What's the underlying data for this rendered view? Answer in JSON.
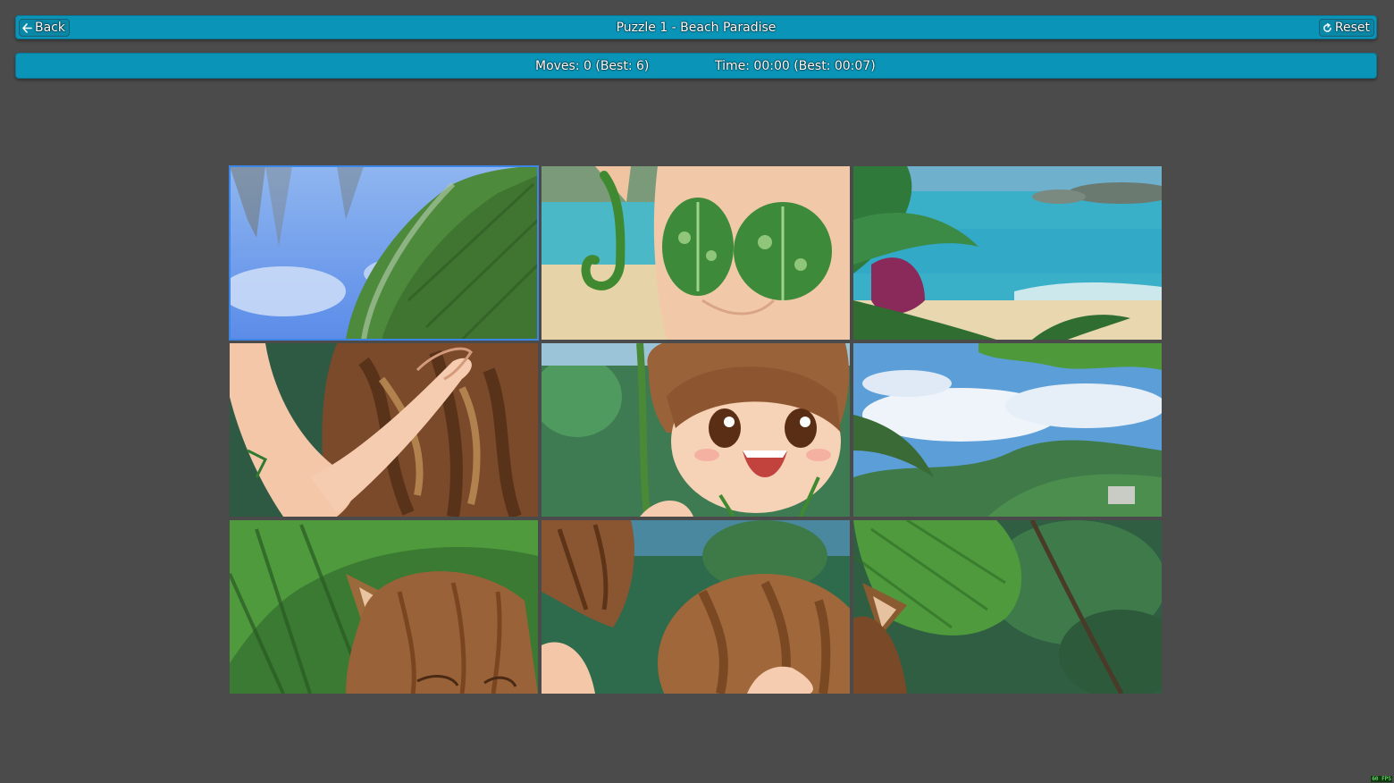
{
  "header": {
    "back_label": "Back",
    "title": "Puzzle 1 - Beach Paradise",
    "reset_label": "Reset"
  },
  "stats": {
    "moves_text": "Moves: 0 (Best: 6)",
    "time_text": "Time: 00:00 (Best: 00:07)"
  },
  "board": {
    "rows": 3,
    "cols": 3,
    "selected_tile": 1,
    "tiles": [
      {
        "position": 1,
        "content": "palm leaf against blue sky"
      },
      {
        "position": 2,
        "content": "leaf bikini top and vine"
      },
      {
        "position": 3,
        "content": "ocean and beach with tropical plants"
      },
      {
        "position": 4,
        "content": "arm and raccoon tail"
      },
      {
        "position": 5,
        "content": "smiling girl face"
      },
      {
        "position": 6,
        "content": "clouds, sky and green hills"
      },
      {
        "position": 7,
        "content": "big leaf and raccoon ears"
      },
      {
        "position": 8,
        "content": "hair and tail with jungle"
      },
      {
        "position": 9,
        "content": "leaf, ear and jungle trees"
      }
    ]
  },
  "fps_text": "60 FPS",
  "colors": {
    "background": "#4b4b4b",
    "bar": "#0a94b7",
    "selection": "#3d86e6"
  }
}
